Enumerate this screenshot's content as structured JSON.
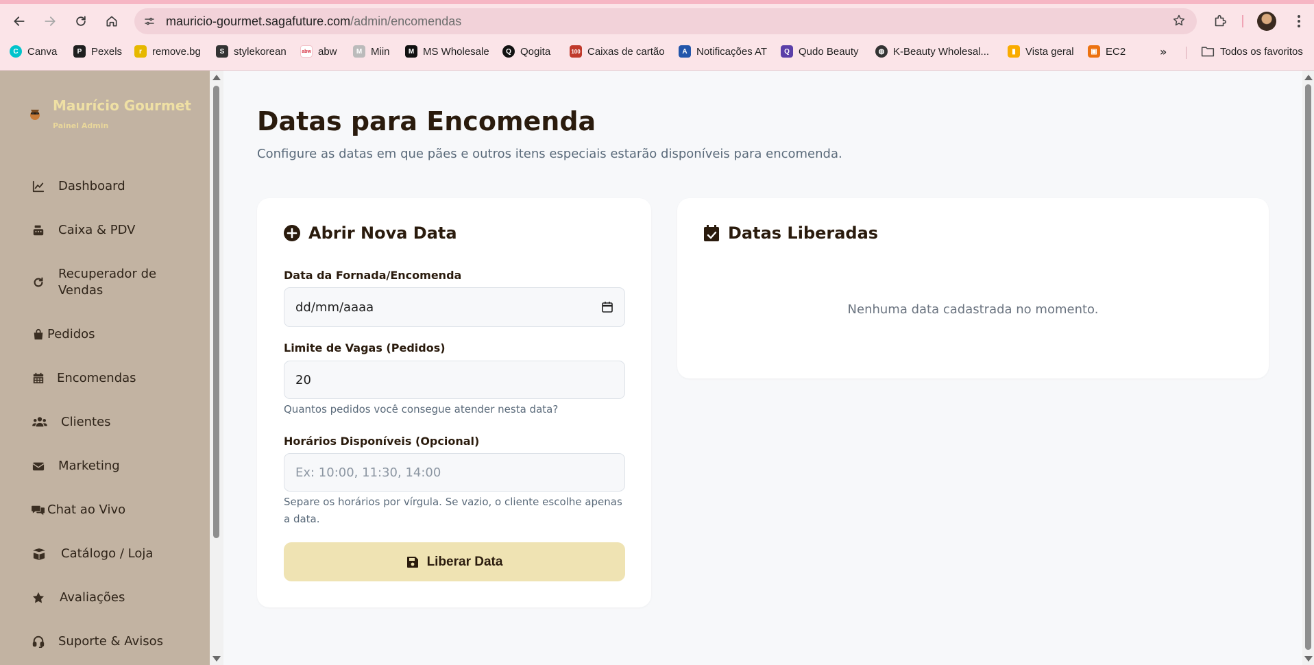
{
  "browser": {
    "url_host": "mauricio-gourmet.sagafuture.com",
    "url_path": "/admin/encomendas",
    "bookmarks": [
      {
        "label": "Canva",
        "icon": "canva-icon",
        "color": "#00c4cc"
      },
      {
        "label": "Pexels",
        "icon": "pexels-icon",
        "color": "#1f1f1f"
      },
      {
        "label": "remove.bg",
        "icon": "removebg-icon",
        "color": "#e6b800"
      },
      {
        "label": "stylekorean",
        "icon": "stylekorean-icon",
        "color": "#333333"
      },
      {
        "label": "abw",
        "icon": "abw-icon",
        "color": "#d63344"
      },
      {
        "label": "Miin",
        "icon": "miin-icon",
        "color": "#888888"
      },
      {
        "label": "MS Wholesale",
        "icon": "mswholesale-icon",
        "color": "#111111"
      },
      {
        "label": "Qogita",
        "icon": "qogita-icon",
        "color": "#111111"
      },
      {
        "label": "Caixas de cartão",
        "icon": "caixas-icon",
        "color": "#c0392b"
      },
      {
        "label": "Notificações AT",
        "icon": "notificacoes-icon",
        "color": "#2255aa"
      },
      {
        "label": "Qudo Beauty",
        "icon": "qudo-icon",
        "color": "#5b3fa8"
      },
      {
        "label": "K-Beauty Wholesal...",
        "icon": "globe-icon",
        "color": "#333333"
      },
      {
        "label": "Vista geral",
        "icon": "analytics-icon",
        "color": "#f9ab00"
      },
      {
        "label": "EC2",
        "icon": "ec2-icon",
        "color": "#ec7211"
      }
    ],
    "more": "»",
    "all_bookmarks": "Todos os favoritos"
  },
  "sidebar": {
    "brand": "Maurício Gourmet",
    "subtitle": "Painel Admin",
    "items": [
      {
        "label": "Dashboard",
        "icon": "chart-line-icon"
      },
      {
        "label": "Caixa & PDV",
        "icon": "cash-register-icon"
      },
      {
        "label": "Recuperador de Vendas",
        "icon": "redo-icon"
      },
      {
        "label": "Pedidos",
        "icon": "shopping-bag-icon"
      },
      {
        "label": "Encomendas",
        "icon": "calendar-icon"
      },
      {
        "label": "Clientes",
        "icon": "users-icon"
      },
      {
        "label": "Marketing",
        "icon": "envelope-icon"
      },
      {
        "label": "Chat ao Vivo",
        "icon": "comments-icon"
      },
      {
        "label": "Catálogo / Loja",
        "icon": "box-open-icon"
      },
      {
        "label": "Avaliações",
        "icon": "star-icon"
      },
      {
        "label": "Suporte & Avisos",
        "icon": "headset-icon"
      }
    ]
  },
  "main": {
    "title": "Datas para Encomenda",
    "subtitle": "Configure as datas em que pães e outros itens especiais estarão disponíveis para encomenda.",
    "form": {
      "title": "Abrir Nova Data",
      "date_label": "Data da Fornada/Encomenda",
      "date_value": "dd/mm/aaaa",
      "limit_label": "Limite de Vagas (Pedidos)",
      "limit_value": "20",
      "limit_hint": "Quantos pedidos você consegue atender nesta data?",
      "times_label": "Horários Disponíveis (Opcional)",
      "times_placeholder": "Ex: 10:00, 11:30, 14:00",
      "times_hint": "Separe os horários por vírgula. Se vazio, o cliente escolhe apenas a data.",
      "submit": "Liberar Data"
    },
    "list": {
      "title": "Datas Liberadas",
      "empty": "Nenhuma data cadastrada no momento."
    }
  },
  "colors": {
    "sidebar_bg": "#c2b3a2",
    "brand": "#efe0a4",
    "button_bg": "#efe3b3",
    "chrome_bg": "#fbe4e8"
  }
}
